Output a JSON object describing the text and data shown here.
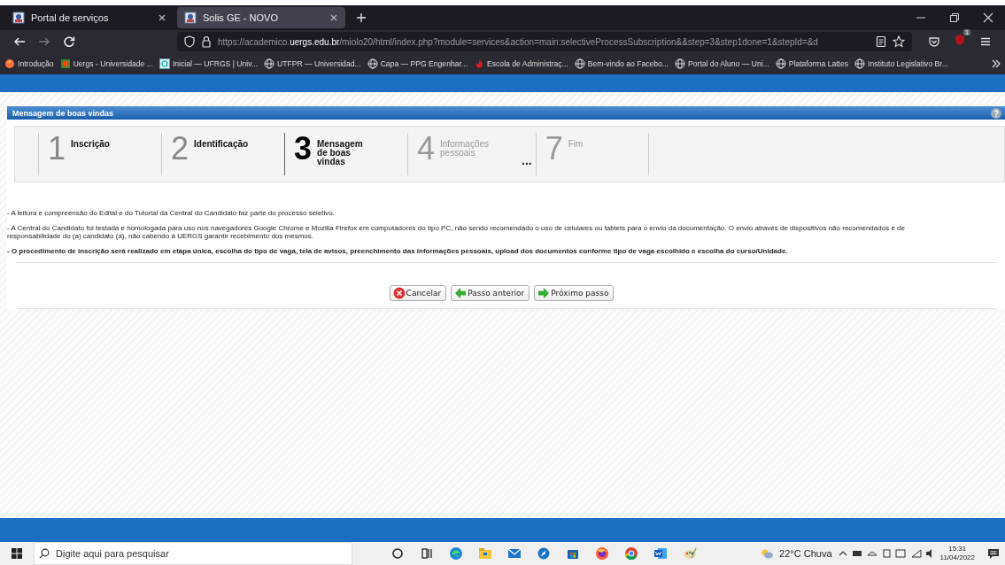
{
  "browser": {
    "tabs": [
      {
        "title": "Portal de serviços",
        "selected": false
      },
      {
        "title": "Solis GE - NOVO",
        "selected": true
      }
    ],
    "url": {
      "prefix": "https://academico.",
      "domain": "uergs.edu.br",
      "rest": "/miolo20/html/index.php?module=services&action=main:selectiveProcessSubscription&&step=3&step1done=1&stepId=&d"
    },
    "extension_badge": "1",
    "bookmarks": [
      {
        "label": "Introdução",
        "kind": "fox"
      },
      {
        "label": "Uergs - Universidade ...",
        "kind": "logo"
      },
      {
        "label": "Inicial — UFRGS | Univ...",
        "kind": "site"
      },
      {
        "label": "UTFPR — Universidad...",
        "kind": "globe"
      },
      {
        "label": "Capa — PPG Engenhar...",
        "kind": "globe"
      },
      {
        "label": "Escola de Administraç...",
        "kind": "flame"
      },
      {
        "label": "Bem-vindo ao Facebo...",
        "kind": "globe"
      },
      {
        "label": "Portal do Aluno — Uni...",
        "kind": "globe"
      },
      {
        "label": "Plataforma Lattes",
        "kind": "globe"
      },
      {
        "label": "Instituto Legislativo Br...",
        "kind": "globe"
      }
    ]
  },
  "page": {
    "panel_title": "Mensagem de boas vindas",
    "steps": [
      {
        "number": "1",
        "label": "Inscrição",
        "selected": false,
        "disabled": false
      },
      {
        "number": "2",
        "label": "Identificação",
        "selected": false,
        "disabled": false
      },
      {
        "number": "3",
        "label": "Mensagem de boas vindas",
        "selected": true,
        "disabled": false
      },
      {
        "number": "4",
        "label": "Informações pessoais",
        "selected": false,
        "disabled": true
      },
      {
        "number": "7",
        "label": "Fim",
        "selected": false,
        "disabled": true
      }
    ],
    "steps_gap": "...",
    "paragraphs": [
      {
        "lines": [
          "- A leitura e compreensão do Edital e do Tutorial da Central do Candidato faz parte do processo seletivo."
        ],
        "bold": false
      },
      {
        "lines": [
          "- A Central do Candidato foi testada e homologada para uso nos navegadores Google Chrome e Mozilla Firefox em computadores  do tipo PC, não sendo recomendado o uso de celulares ou tablets para o envio da documentação. O envio através de dispositivos não recomendados é de",
          "responsabilidade do (a) candidato (a), não cabendo à UERGS garantir recebimento dos mesmos."
        ],
        "bold": false
      },
      {
        "lines": [
          "- O procedimento de inscrição será realizado em etapa única, escolha do tipo de vaga, tela de avisos, preenchimento das informações pessoais, upload dos documentos conforme tipo de vaga escolhido e escolha do curso/Unidade."
        ],
        "bold": true
      }
    ],
    "buttons": [
      {
        "label": "Cancelar",
        "kind": "cancel"
      },
      {
        "label": "Passo anterior",
        "kind": "back"
      },
      {
        "label": "Próximo passo",
        "kind": "next"
      }
    ]
  },
  "taskbar": {
    "search_placeholder": "Digite aqui para pesquisar",
    "apps": [
      {
        "kind": "cortana"
      },
      {
        "kind": "taskview"
      },
      {
        "kind": "edge"
      },
      {
        "kind": "files"
      },
      {
        "kind": "mail"
      },
      {
        "kind": "app"
      },
      {
        "kind": "store"
      },
      {
        "kind": "firefox"
      },
      {
        "kind": "chrome"
      },
      {
        "kind": "word"
      },
      {
        "kind": "paint"
      }
    ],
    "weather": "22°C Chuva",
    "time": "15:31",
    "date": "11/04/2022"
  }
}
